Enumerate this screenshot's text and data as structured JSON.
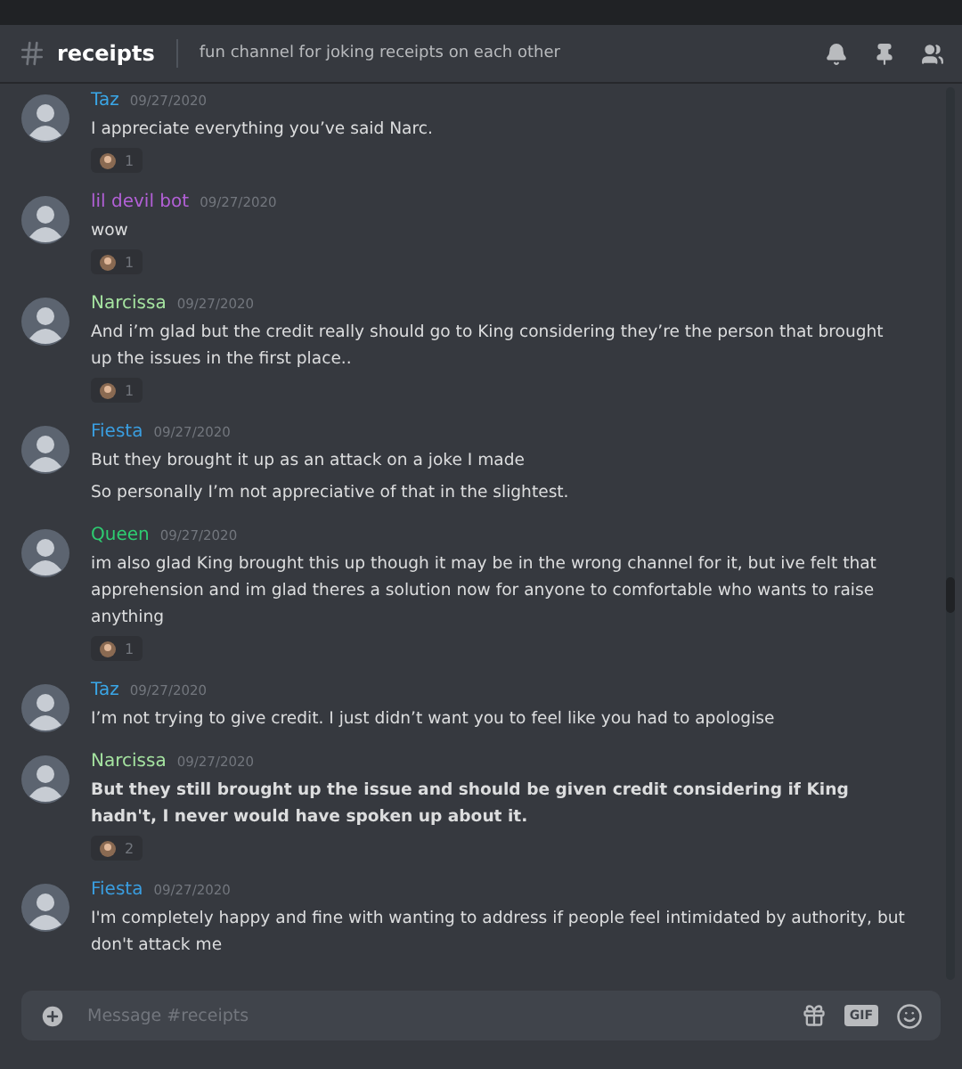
{
  "header": {
    "channel": "receipts",
    "topic": "fun channel for joking receipts on each other"
  },
  "messages": [
    {
      "author": "Taz",
      "color": "#3aa6e6",
      "time": "09/27/2020",
      "bold": false,
      "lines": [
        "I appreciate everything you’ve said Narc."
      ],
      "reaction": {
        "count": "1"
      }
    },
    {
      "author": "lil devil bot",
      "color": "#b260d6",
      "time": "09/27/2020",
      "bold": false,
      "lines": [
        "wow"
      ],
      "reaction": {
        "count": "1"
      }
    },
    {
      "author": "Narcissa",
      "color": "#a5e3a0",
      "time": "09/27/2020",
      "bold": false,
      "lines": [
        "And i’m glad but the credit really should go to King considering they’re the person that brought up the issues in the first place.."
      ],
      "reaction": {
        "count": "1"
      }
    },
    {
      "author": "Fiesta",
      "color": "#3a9ee0",
      "time": "09/27/2020",
      "bold": false,
      "lines": [
        "But they brought it up as an attack on a joke I made",
        "So personally I’m not appreciative of that in the slightest."
      ]
    },
    {
      "author": "Queen",
      "color": "#2ecc71",
      "time": "09/27/2020",
      "bold": false,
      "lines": [
        "im also glad King brought this up though it may be in the wrong channel for it, but ive felt that apprehension and im glad theres a solution now for anyone to comfortable who wants to raise anything"
      ],
      "reaction": {
        "count": "1"
      }
    },
    {
      "author": "Taz",
      "color": "#3aa6e6",
      "time": "09/27/2020",
      "bold": false,
      "lines": [
        "I’m not trying to give credit. I just didn’t want you to feel like you had to apologise"
      ]
    },
    {
      "author": "Narcissa",
      "color": "#a5e3a0",
      "time": "09/27/2020",
      "bold": true,
      "lines": [
        "But they still brought up the issue and should be given credit considering if King hadn't, I never would have spoken up about it."
      ],
      "reaction": {
        "count": "2"
      }
    },
    {
      "author": "Fiesta",
      "color": "#3a9ee0",
      "time": "09/27/2020",
      "bold": false,
      "lines": [
        "I'm completely happy and fine with wanting to address if people feel intimidated by authority, but don't attack me"
      ]
    }
  ],
  "composer": {
    "placeholder": "Message #receipts",
    "gif": "GIF"
  }
}
